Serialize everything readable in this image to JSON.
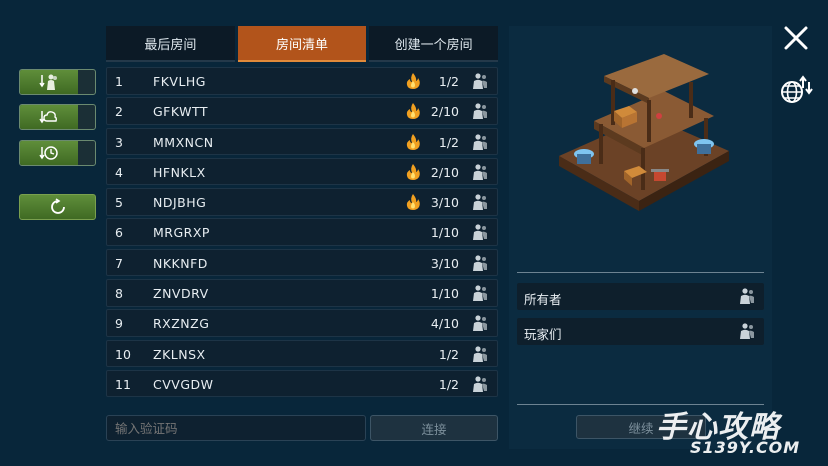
{
  "tabs": [
    {
      "label": "最后房间",
      "active": false
    },
    {
      "label": "房间清单",
      "active": true
    },
    {
      "label": "创建一个房间",
      "active": false
    }
  ],
  "side_buttons": [
    {
      "icon": "players-sort-icon"
    },
    {
      "icon": "cloud-sort-icon"
    },
    {
      "icon": "clock-sort-icon"
    }
  ],
  "refresh_icon": "refresh-icon",
  "rooms": [
    {
      "num": "1",
      "name": "FKVLHG",
      "hot": true,
      "count": "1/2"
    },
    {
      "num": "2",
      "name": "GFKWTT",
      "hot": true,
      "count": "2/10"
    },
    {
      "num": "3",
      "name": "MMXNCN",
      "hot": true,
      "count": "1/2"
    },
    {
      "num": "4",
      "name": "HFNKLX",
      "hot": true,
      "count": "2/10"
    },
    {
      "num": "5",
      "name": "NDJBHG",
      "hot": true,
      "count": "3/10"
    },
    {
      "num": "6",
      "name": "MRGRXP",
      "hot": false,
      "count": "1/10"
    },
    {
      "num": "7",
      "name": "NKKNFD",
      "hot": false,
      "count": "3/10"
    },
    {
      "num": "8",
      "name": "ZNVDRV",
      "hot": false,
      "count": "1/10"
    },
    {
      "num": "9",
      "name": "RXZNZG",
      "hot": false,
      "count": "4/10"
    },
    {
      "num": "10",
      "name": "ZKLNSX",
      "hot": false,
      "count": "1/2"
    },
    {
      "num": "11",
      "name": "CVVGDW",
      "hot": false,
      "count": "1/2"
    }
  ],
  "code_input": {
    "placeholder": "输入验证码",
    "value": ""
  },
  "connect_label": "连接",
  "details": {
    "owner_label": "所有者",
    "players_label": "玩家们",
    "continue_label": "继续"
  },
  "watermark": {
    "big": "手心攻略",
    "small": "S139Y.COM"
  },
  "colors": {
    "background": "#08263a",
    "tab_active": "#b2541b",
    "button_green": "#5f8e3a",
    "fire": "#f0a020"
  }
}
